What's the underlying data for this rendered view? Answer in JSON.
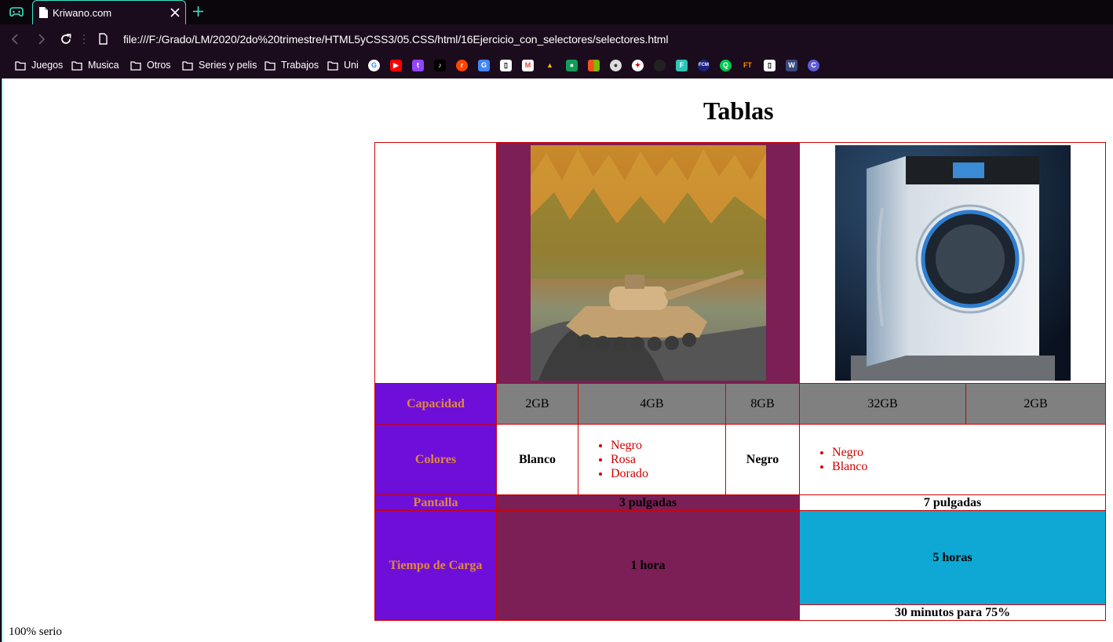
{
  "browser": {
    "tab_title": "Kriwano.com",
    "url": "file:///F:/Grado/LM/2020/2do%20trimestre/HTML5yCSS3/05.CSS/html/16Ejercicio_con_selectores/selectores.html",
    "accent_color": "#37e6c9",
    "bookmark_folders": [
      "Juegos",
      "Musica",
      "Otros",
      "Series y pelis",
      "Trabajos",
      "Uni"
    ],
    "bookmark_icons": [
      "google-icon",
      "youtube-icon",
      "twitch-icon",
      "tiktok-icon",
      "reddit-icon",
      "translate-icon",
      "doc-icon",
      "gmail-icon",
      "drive-icon",
      "classroom-icon",
      "microsoft-icon",
      "ball-icon",
      "mugen-icon",
      "circle-icon",
      "f-icon",
      "fcm-icon",
      "q-icon",
      "ft-icon",
      "doc-icon",
      "wolf-icon",
      "c-icon"
    ]
  },
  "page": {
    "title": "Tablas",
    "footer": "100% serio"
  },
  "table": {
    "images": [
      "tank-photo",
      "washing-machine-photo"
    ],
    "rows": {
      "capacidad": {
        "label": "Capacidad",
        "values": [
          "2GB",
          "4GB",
          "8GB",
          "32GB",
          "2GB"
        ]
      },
      "colores": {
        "label": "Colores",
        "p1_first": "Blanco",
        "p1_list": [
          "Negro",
          "Rosa",
          "Dorado"
        ],
        "p1_last": "Negro",
        "p2_list": [
          "Negro",
          "Blanco"
        ]
      },
      "pantalla": {
        "label": "Pantalla",
        "p1": "3 pulgadas",
        "p2": "7 pulgadas"
      },
      "tiempo": {
        "label": "Tiempo de Carga",
        "p1": "1 hora",
        "p2": "5 horas",
        "p2_extra": "30 minutos para 75%"
      }
    },
    "colors": {
      "label_bg": "#6e0fd9",
      "label_text": "#e0893a",
      "border": "#d00000",
      "gray": "#808080",
      "maroon": "#7b1f56",
      "cyan": "#0fa8d4"
    }
  }
}
